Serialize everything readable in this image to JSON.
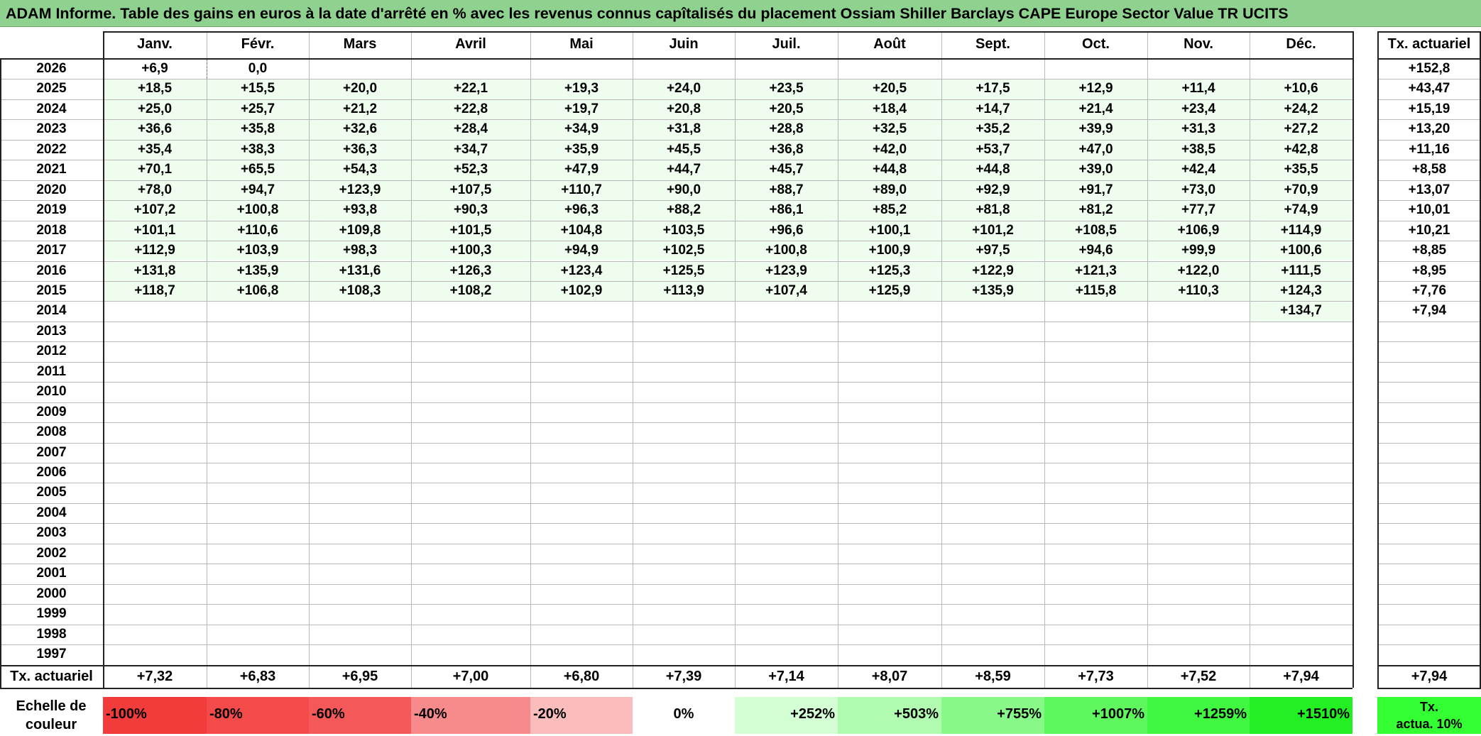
{
  "title": "ADAM Informe. Table des gains en euros à la date d'arrêté en % avec les revenus connus capîtalisés du placement Ossiam Shiller Barclays CAPE Europe Sector Value TR UCITS",
  "columns": [
    "Janv.",
    "Févr.",
    "Mars",
    "Avril",
    "Mai",
    "Juin",
    "Juil.",
    "Août",
    "Sept.",
    "Oct.",
    "Nov.",
    "Déc."
  ],
  "tx_header": "Tx. actuariel",
  "rows": [
    {
      "year": "2026",
      "values": [
        "+6,9",
        "0,0",
        "",
        "",
        "",
        "",
        "",
        "",
        "",
        "",
        "",
        ""
      ],
      "tx": "+152,8"
    },
    {
      "year": "2025",
      "values": [
        "+18,5",
        "+15,5",
        "+20,0",
        "+22,1",
        "+19,3",
        "+24,0",
        "+23,5",
        "+20,5",
        "+17,5",
        "+12,9",
        "+11,4",
        "+10,6"
      ],
      "tx": "+43,47"
    },
    {
      "year": "2024",
      "values": [
        "+25,0",
        "+25,7",
        "+21,2",
        "+22,8",
        "+19,7",
        "+20,8",
        "+20,5",
        "+18,4",
        "+14,7",
        "+21,4",
        "+23,4",
        "+24,2"
      ],
      "tx": "+15,19"
    },
    {
      "year": "2023",
      "values": [
        "+36,6",
        "+35,8",
        "+32,6",
        "+28,4",
        "+34,9",
        "+31,8",
        "+28,8",
        "+32,5",
        "+35,2",
        "+39,9",
        "+31,3",
        "+27,2"
      ],
      "tx": "+13,20"
    },
    {
      "year": "2022",
      "values": [
        "+35,4",
        "+38,3",
        "+36,3",
        "+34,7",
        "+35,9",
        "+45,5",
        "+36,8",
        "+42,0",
        "+53,7",
        "+47,0",
        "+38,5",
        "+42,8"
      ],
      "tx": "+11,16"
    },
    {
      "year": "2021",
      "values": [
        "+70,1",
        "+65,5",
        "+54,3",
        "+52,3",
        "+47,9",
        "+44,7",
        "+45,7",
        "+44,8",
        "+44,8",
        "+39,0",
        "+42,4",
        "+35,5"
      ],
      "tx": "+8,58"
    },
    {
      "year": "2020",
      "values": [
        "+78,0",
        "+94,7",
        "+123,9",
        "+107,5",
        "+110,7",
        "+90,0",
        "+88,7",
        "+89,0",
        "+92,9",
        "+91,7",
        "+73,0",
        "+70,9"
      ],
      "tx": "+13,07"
    },
    {
      "year": "2019",
      "values": [
        "+107,2",
        "+100,8",
        "+93,8",
        "+90,3",
        "+96,3",
        "+88,2",
        "+86,1",
        "+85,2",
        "+81,8",
        "+81,2",
        "+77,7",
        "+74,9"
      ],
      "tx": "+10,01"
    },
    {
      "year": "2018",
      "values": [
        "+101,1",
        "+110,6",
        "+109,8",
        "+101,5",
        "+104,8",
        "+103,5",
        "+96,6",
        "+100,1",
        "+101,2",
        "+108,5",
        "+106,9",
        "+114,9"
      ],
      "tx": "+10,21"
    },
    {
      "year": "2017",
      "values": [
        "+112,9",
        "+103,9",
        "+98,3",
        "+100,3",
        "+94,9",
        "+102,5",
        "+100,8",
        "+100,9",
        "+97,5",
        "+94,6",
        "+99,9",
        "+100,6"
      ],
      "tx": "+8,85"
    },
    {
      "year": "2016",
      "values": [
        "+131,8",
        "+135,9",
        "+131,6",
        "+126,3",
        "+123,4",
        "+125,5",
        "+123,9",
        "+125,3",
        "+122,9",
        "+121,3",
        "+122,0",
        "+111,5"
      ],
      "tx": "+8,95"
    },
    {
      "year": "2015",
      "values": [
        "+118,7",
        "+106,8",
        "+108,3",
        "+108,2",
        "+102,9",
        "+113,9",
        "+107,4",
        "+125,9",
        "+135,9",
        "+115,8",
        "+110,3",
        "+124,3"
      ],
      "tx": "+7,76"
    },
    {
      "year": "2014",
      "values": [
        "",
        "",
        "",
        "",
        "",
        "",
        "",
        "",
        "",
        "",
        "",
        "+134,7"
      ],
      "tx": "+7,94"
    },
    {
      "year": "2013",
      "values": [
        "",
        "",
        "",
        "",
        "",
        "",
        "",
        "",
        "",
        "",
        "",
        ""
      ],
      "tx": ""
    },
    {
      "year": "2012",
      "values": [
        "",
        "",
        "",
        "",
        "",
        "",
        "",
        "",
        "",
        "",
        "",
        ""
      ],
      "tx": ""
    },
    {
      "year": "2011",
      "values": [
        "",
        "",
        "",
        "",
        "",
        "",
        "",
        "",
        "",
        "",
        "",
        ""
      ],
      "tx": ""
    },
    {
      "year": "2010",
      "values": [
        "",
        "",
        "",
        "",
        "",
        "",
        "",
        "",
        "",
        "",
        "",
        ""
      ],
      "tx": ""
    },
    {
      "year": "2009",
      "values": [
        "",
        "",
        "",
        "",
        "",
        "",
        "",
        "",
        "",
        "",
        "",
        ""
      ],
      "tx": ""
    },
    {
      "year": "2008",
      "values": [
        "",
        "",
        "",
        "",
        "",
        "",
        "",
        "",
        "",
        "",
        "",
        ""
      ],
      "tx": ""
    },
    {
      "year": "2007",
      "values": [
        "",
        "",
        "",
        "",
        "",
        "",
        "",
        "",
        "",
        "",
        "",
        ""
      ],
      "tx": ""
    },
    {
      "year": "2006",
      "values": [
        "",
        "",
        "",
        "",
        "",
        "",
        "",
        "",
        "",
        "",
        "",
        ""
      ],
      "tx": ""
    },
    {
      "year": "2005",
      "values": [
        "",
        "",
        "",
        "",
        "",
        "",
        "",
        "",
        "",
        "",
        "",
        ""
      ],
      "tx": ""
    },
    {
      "year": "2004",
      "values": [
        "",
        "",
        "",
        "",
        "",
        "",
        "",
        "",
        "",
        "",
        "",
        ""
      ],
      "tx": ""
    },
    {
      "year": "2003",
      "values": [
        "",
        "",
        "",
        "",
        "",
        "",
        "",
        "",
        "",
        "",
        "",
        ""
      ],
      "tx": ""
    },
    {
      "year": "2002",
      "values": [
        "",
        "",
        "",
        "",
        "",
        "",
        "",
        "",
        "",
        "",
        "",
        ""
      ],
      "tx": ""
    },
    {
      "year": "2001",
      "values": [
        "",
        "",
        "",
        "",
        "",
        "",
        "",
        "",
        "",
        "",
        "",
        ""
      ],
      "tx": ""
    },
    {
      "year": "2000",
      "values": [
        "",
        "",
        "",
        "",
        "",
        "",
        "",
        "",
        "",
        "",
        "",
        ""
      ],
      "tx": ""
    },
    {
      "year": "1999",
      "values": [
        "",
        "",
        "",
        "",
        "",
        "",
        "",
        "",
        "",
        "",
        "",
        ""
      ],
      "tx": ""
    },
    {
      "year": "1998",
      "values": [
        "",
        "",
        "",
        "",
        "",
        "",
        "",
        "",
        "",
        "",
        "",
        ""
      ],
      "tx": ""
    },
    {
      "year": "1997",
      "values": [
        "",
        "",
        "",
        "",
        "",
        "",
        "",
        "",
        "",
        "",
        "",
        ""
      ],
      "tx": ""
    }
  ],
  "footer": {
    "label": "Tx. actuariel",
    "values": [
      "+7,32",
      "+6,83",
      "+6,95",
      "+7,00",
      "+6,80",
      "+7,39",
      "+7,14",
      "+8,07",
      "+8,59",
      "+7,73",
      "+7,52",
      "+7,94"
    ],
    "tx": "+7,94"
  },
  "scale": {
    "label_line1": "Echelle de",
    "label_line2": "couleur",
    "items": [
      "-100%",
      "-80%",
      "-60%",
      "-40%",
      "-20%",
      "0%",
      "+252%",
      "+503%",
      "+755%",
      "+1007%",
      "+1259%",
      "+1510%"
    ],
    "colors": [
      "#f23c3c",
      "#f44a4a",
      "#f45858",
      "#f78a8a",
      "#fbbcbc",
      "#ffffff",
      "#d4fed4",
      "#b1fbb1",
      "#88f888",
      "#5ef85e",
      "#3ff83f",
      "#23f023"
    ],
    "last_line1": "Tx.",
    "last_line2": "actua. 10%",
    "last_color": "#33ff33"
  },
  "colors": {
    "title_bg": "#8fd18f",
    "cell_tint": "#eefdee"
  }
}
